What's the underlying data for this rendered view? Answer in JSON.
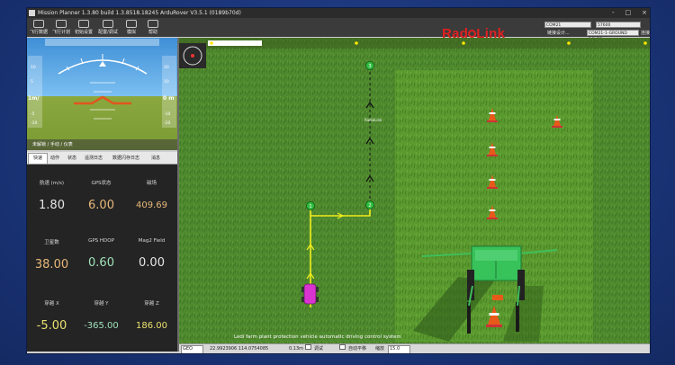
{
  "window": {
    "title": "Mission Planner 1.3.80 build 1.3.8518.18245 ArduRover V3.5.1 (0189b70d)",
    "controls": [
      "-",
      "□",
      "×"
    ]
  },
  "menu": {
    "items": [
      {
        "label": "飞行数据",
        "icon": "flight-data-icon"
      },
      {
        "label": "飞行计划",
        "icon": "flight-plan-icon"
      },
      {
        "label": "初始设置",
        "icon": "initial-setup-icon"
      },
      {
        "label": "配置/调试",
        "icon": "config-tuning-icon"
      },
      {
        "label": "模拟",
        "icon": "simulation-icon"
      },
      {
        "label": "帮助",
        "icon": "help-icon"
      }
    ]
  },
  "brand": {
    "left": "RadioLink",
    "color": "#e02020"
  },
  "connection": {
    "port": "COM21",
    "baud": "57600",
    "link_label": "链接设计...",
    "link_target": "COM21-1-GROUND ROVER",
    "connect_label": "连接"
  },
  "hud": {
    "left_edge_label": "1m/",
    "right_edge_label": "0 m",
    "status_text": "未解锁 / 手动 / 仪表"
  },
  "tabs": {
    "items": [
      "快速",
      "动作",
      "状态",
      "遥测日志",
      "数据闪存日志",
      "消息"
    ],
    "active_index": 0
  },
  "quick": {
    "cells": [
      {
        "label": "航速 (m/s)",
        "value": "1.80",
        "color": "#e6e6e6"
      },
      {
        "label": "GPS状态",
        "value": "6.00",
        "color": "#e8b87a"
      },
      {
        "label": "磁场",
        "value": "409.69",
        "color": "#e8b87a"
      },
      {
        "label": "卫星数",
        "value": "38.00",
        "color": "#e8b87a"
      },
      {
        "label": "GPS HDOP",
        "value": "0.60",
        "color": "#9fe0b8"
      },
      {
        "label": "Mag2 Field",
        "value": "0.00",
        "color": "#e6e6e6"
      },
      {
        "label": "穿越 X",
        "value": "-5.00",
        "color": "#e8e070"
      },
      {
        "label": "穿越 Y",
        "value": "-365.00",
        "color": "#9fe0b8"
      },
      {
        "label": "穿越 Z",
        "value": "186.00",
        "color": "#e8e070"
      }
    ]
  },
  "map": {
    "waypoints": [
      "1",
      "2",
      "3"
    ],
    "photo_label": "RadioLink",
    "caption": "Ledi farm plant protection vehicle automatic driving control system"
  },
  "statusbar": {
    "zoom_select": "GEO",
    "coords": "22.9923906 114.0754085",
    "alt": "0.13m",
    "chk1_label": "调试",
    "chk2_label": "自动平移",
    "zoom_label": "缩放",
    "zoom_value": "15.0"
  }
}
